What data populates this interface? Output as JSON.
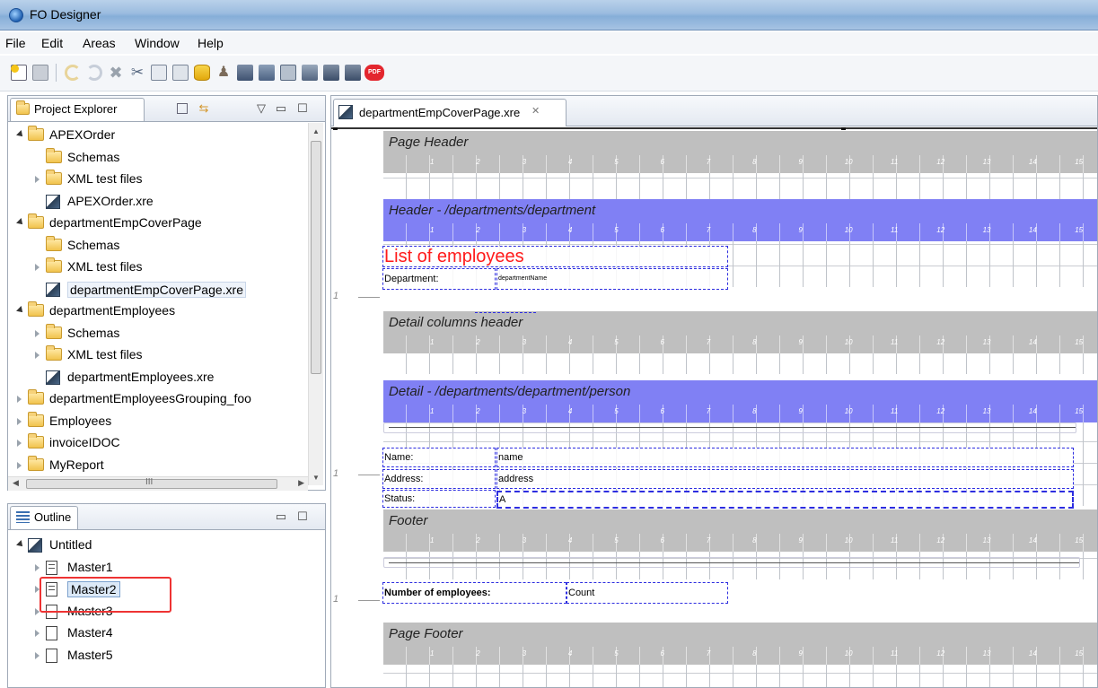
{
  "window": {
    "title": "FO Designer"
  },
  "menu": [
    "File",
    "Edit",
    "Areas",
    "Window",
    "Help"
  ],
  "toolbar": {
    "icons": [
      "new-icon",
      "save-icon",
      "separator",
      "undo-icon",
      "redo-icon",
      "delete-icon",
      "cut-icon",
      "copy-icon",
      "paste-icon",
      "database-icon",
      "people-icon",
      "open-folder-icon",
      "open-image-icon",
      "layout-icon",
      "export-icon",
      "export-folder-icon",
      "open-folder-2-icon",
      "pdf-icon"
    ],
    "pdf_label": "PDF"
  },
  "project_explorer": {
    "tab_label": "Project Explorer",
    "tree": [
      {
        "label": "APEXOrder",
        "type": "project",
        "state": "open",
        "depth": 0
      },
      {
        "label": "Schemas",
        "type": "folder",
        "state": "none",
        "depth": 1
      },
      {
        "label": "XML test files",
        "type": "folder",
        "state": "closed",
        "depth": 1
      },
      {
        "label": "APEXOrder.xre",
        "type": "xre",
        "state": "none",
        "depth": 1
      },
      {
        "label": "departmentEmpCoverPage",
        "type": "project",
        "state": "open",
        "depth": 0
      },
      {
        "label": "Schemas",
        "type": "folder",
        "state": "none",
        "depth": 1
      },
      {
        "label": "XML test files",
        "type": "folder",
        "state": "closed",
        "depth": 1
      },
      {
        "label": "departmentEmpCoverPage.xre",
        "type": "xre",
        "state": "none",
        "depth": 1,
        "selected": true
      },
      {
        "label": "departmentEmployees",
        "type": "project",
        "state": "open",
        "depth": 0
      },
      {
        "label": "Schemas",
        "type": "folder",
        "state": "closed",
        "depth": 1
      },
      {
        "label": "XML test files",
        "type": "folder",
        "state": "closed",
        "depth": 1
      },
      {
        "label": "departmentEmployees.xre",
        "type": "xre",
        "state": "none",
        "depth": 1
      },
      {
        "label": "departmentEmployeesGrouping_foo",
        "type": "project",
        "state": "closed",
        "depth": 0
      },
      {
        "label": "Employees",
        "type": "project",
        "state": "closed",
        "depth": 0
      },
      {
        "label": "invoiceIDOC",
        "type": "project",
        "state": "closed",
        "depth": 0
      },
      {
        "label": "MyReport",
        "type": "project",
        "state": "closed",
        "depth": 0
      }
    ],
    "hscroll_glyph": "III"
  },
  "outline": {
    "tab_label": "Outline",
    "tree": [
      {
        "label": "Untitled",
        "type": "xre",
        "state": "open",
        "depth": 0
      },
      {
        "label": "Master1",
        "type": "doc-lines",
        "state": "closed",
        "depth": 1
      },
      {
        "label": "Master2",
        "type": "doc-lines",
        "state": "closed",
        "depth": 1,
        "highlighted": true
      },
      {
        "label": "Master3",
        "type": "doc",
        "state": "closed",
        "depth": 1
      },
      {
        "label": "Master4",
        "type": "doc",
        "state": "closed",
        "depth": 1
      },
      {
        "label": "Master5",
        "type": "doc",
        "state": "closed",
        "depth": 1
      }
    ]
  },
  "editor": {
    "tab_label": "departmentEmpCoverPage.xre",
    "close_glyph": "✕",
    "ruler_numbers": [
      "1",
      "2",
      "3",
      "4",
      "5",
      "6",
      "7",
      "8",
      "9",
      "10",
      "11",
      "12",
      "13",
      "14",
      "15"
    ],
    "line_number": "1",
    "bands": [
      {
        "title": "Page Header",
        "color": "gray"
      },
      {
        "title": "Header - /departments/department",
        "color": "blue"
      },
      {
        "title": "Detail columns header",
        "color": "gray"
      },
      {
        "title": "Detail - /departments/department/person",
        "color": "blue"
      },
      {
        "title": "Footer",
        "color": "gray"
      },
      {
        "title": "Page Footer",
        "color": "gray"
      }
    ],
    "fields": {
      "list_title": "List of employees",
      "department_label": "Department:",
      "department_value": "departmentName",
      "name_label": "Name:",
      "name_value": "name",
      "address_label": "Address:",
      "address_value": "address",
      "status_label": "Status:",
      "status_value": "A",
      "count_label": "Number of employees:",
      "count_value": "Count"
    }
  },
  "colors": {
    "band_gray": "#bfbfbf",
    "band_blue": "#8080f4",
    "field_border": "#2d2de0",
    "title_red": "#ff1a1a",
    "highlight_red": "#e33333"
  }
}
